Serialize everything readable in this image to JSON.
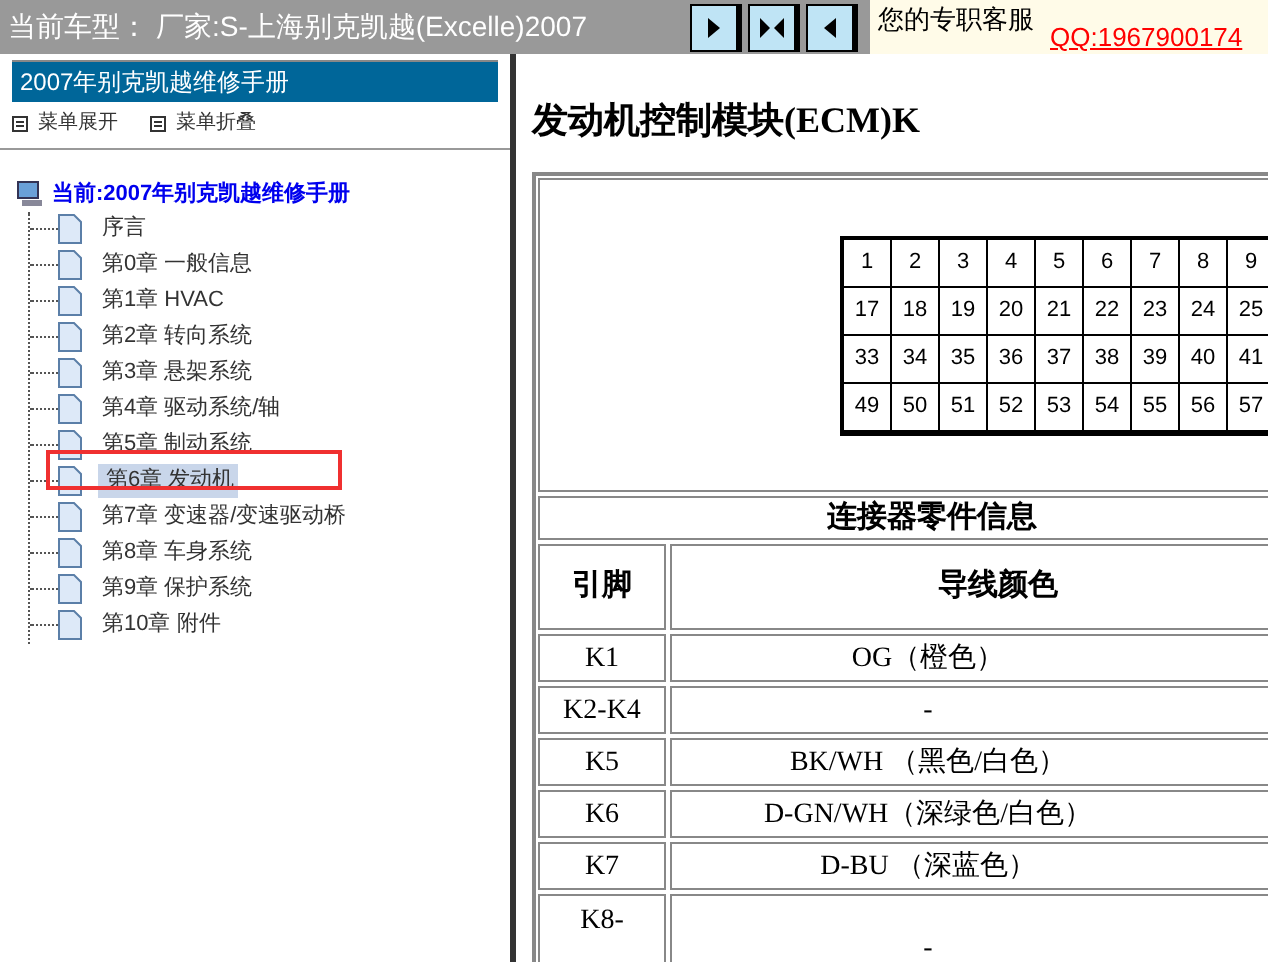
{
  "top_bar": {
    "model_label": "当前车型：",
    "model_value": "厂家:S-上海别克凯越(Excelle)2007",
    "support_label": "您的专职客服",
    "support_link": "QQ:1967900174"
  },
  "toolbar_buttons": [
    {
      "kind": "right"
    },
    {
      "kind": "both"
    },
    {
      "kind": "left"
    }
  ],
  "sidebar": {
    "title": "2007年别克凯越维修手册",
    "menu": [
      {
        "label": "菜单展开"
      },
      {
        "label": "菜单折叠"
      }
    ],
    "tree": {
      "label": "当前:2007年别克凯越维修手册",
      "children": [
        {
          "label": "序言",
          "selected": false
        },
        {
          "label": "第0章 一般信息",
          "selected": false
        },
        {
          "label": "第1章 HVAC",
          "selected": false
        },
        {
          "label": "第2章 转向系统",
          "selected": false
        },
        {
          "label": "第3章 悬架系统",
          "selected": false
        },
        {
          "label": "第4章 驱动系统/轴",
          "selected": false
        },
        {
          "label": "第5章 制动系统",
          "selected": false
        },
        {
          "label": "第6章 发动机",
          "selected": true
        },
        {
          "label": "第7章 变速器/变速驱动桥",
          "selected": false
        },
        {
          "label": "第8章 车身系统",
          "selected": false
        },
        {
          "label": "第9章 保护系统",
          "selected": false
        },
        {
          "label": "第10章 附件",
          "selected": false
        }
      ]
    }
  },
  "content": {
    "title": "发动机控制模块(ECM)K",
    "connector_pins": [
      [
        "1",
        "2",
        "3",
        "4",
        "5",
        "6",
        "7",
        "8",
        "9"
      ],
      [
        "17",
        "18",
        "19",
        "20",
        "21",
        "22",
        "23",
        "24",
        "25"
      ],
      [
        "33",
        "34",
        "35",
        "36",
        "37",
        "38",
        "39",
        "40",
        "41"
      ],
      [
        "49",
        "50",
        "51",
        "52",
        "53",
        "54",
        "55",
        "56",
        "57"
      ]
    ],
    "table": {
      "caption": "连接器零件信息",
      "columns": [
        "引脚",
        "导线颜色"
      ],
      "rows": [
        [
          "K1",
          "OG（橙色）"
        ],
        [
          "K2-K4",
          "-"
        ],
        [
          "K5",
          "BK/WH （黑色/白色）"
        ],
        [
          "K6",
          "D-GN/WH（深绿色/白色）"
        ],
        [
          "K7",
          "D-BU （深蓝色）"
        ],
        [
          "K8-",
          "-"
        ]
      ]
    }
  }
}
